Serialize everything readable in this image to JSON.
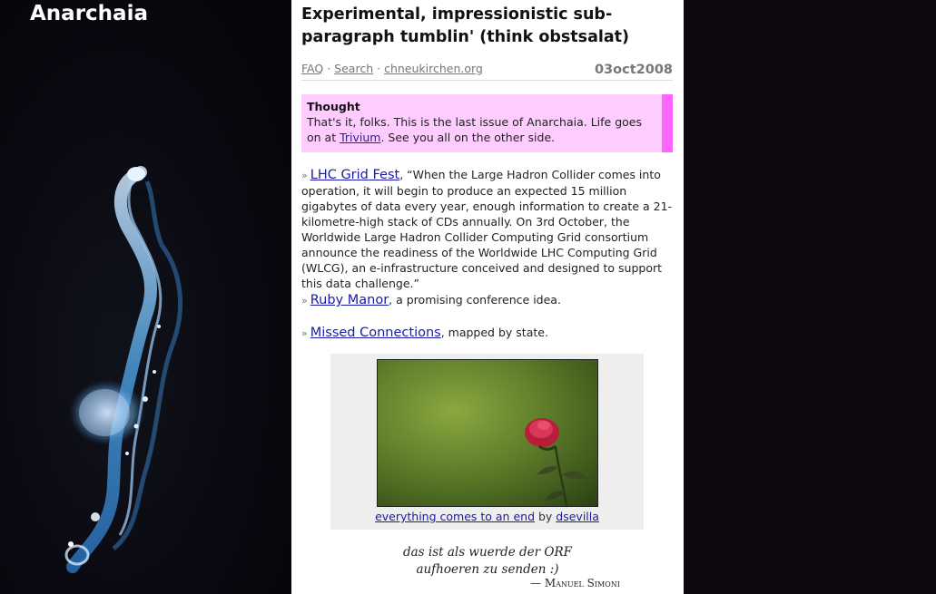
{
  "site": {
    "title": "Anarchaia"
  },
  "headline": "Experimental, impressionistic sub-paragraph tumblin' (think obstsalat)",
  "nav": {
    "faq": "FAQ",
    "search": "Search",
    "site": "chneukirchen.org",
    "separator": "·"
  },
  "date": "03oct2008",
  "thought": {
    "title": "Thought",
    "text_before": "That's it, folks.  This is the last issue of Anarchaia.  Life goes on at ",
    "link": "Trivium",
    "text_after": ".  See you all on the other side."
  },
  "entries": [
    {
      "marker": "»",
      "link": "LHC Grid Fest",
      "text": ", “When the Large Hadron Collider comes into operation, it will begin to produce an expected 15 million gigabytes of data every year, enough information to create a 21-kilometre-high stack of CDs annually.  On 3rd October, the Worldwide Large Hadron Collider Computing Grid consortium announce the readiness of the Worldwide LHC Computing Grid (WLCG), an e-infrastructure conceived and designed to support this data challenge.”"
    },
    {
      "marker": "»",
      "link": "Ruby Manor",
      "text": ", a promising conference idea."
    },
    {
      "marker": "»",
      "link": "Missed Connections",
      "text": ", mapped by state."
    }
  ],
  "photo": {
    "caption_link": "everything comes to an end",
    "caption_by": " by ",
    "author_link": "dsevilla"
  },
  "quote": {
    "line1": "das ist als wuerde der ORF",
    "line2": "aufhoeren zu senden :)",
    "author": "— Manuel Simoni"
  }
}
